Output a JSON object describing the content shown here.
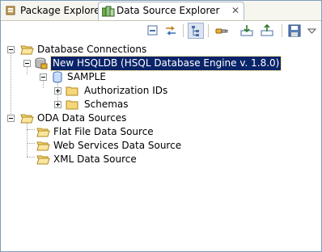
{
  "tabs": [
    {
      "label": "Package Explorer",
      "icon": "package-explorer-icon",
      "active": false
    },
    {
      "label": "Data Source Explorer",
      "icon": "data-source-explorer-icon",
      "active": true
    }
  ],
  "tab_close_glyph": "✕",
  "toolbar": [
    "collapse-all-icon",
    "link-with-editor-icon",
    "hierarchy-icon",
    "connect-icon",
    "import-icon",
    "export-icon",
    "save-icon",
    "view-menu-icon"
  ],
  "tree": {
    "database_connections": {
      "label": "Database Connections",
      "children": {
        "connection": {
          "label": "New HSQLDB (HSQL Database Engine v. 1.8.0)",
          "selected": true
        },
        "database": {
          "label": "SAMPLE"
        },
        "authorization": {
          "label": "Authorization IDs"
        },
        "schemas": {
          "label": "Schemas"
        }
      }
    },
    "oda_data_sources": {
      "label": "ODA Data Sources",
      "children": [
        {
          "label": "Flat File Data Source"
        },
        {
          "label": "Web Services Data Source"
        },
        {
          "label": "XML Data Source"
        }
      ]
    }
  },
  "colors": {
    "selection": "#0a246a",
    "folder": "#f5d67a",
    "border": "#7f9db9"
  }
}
